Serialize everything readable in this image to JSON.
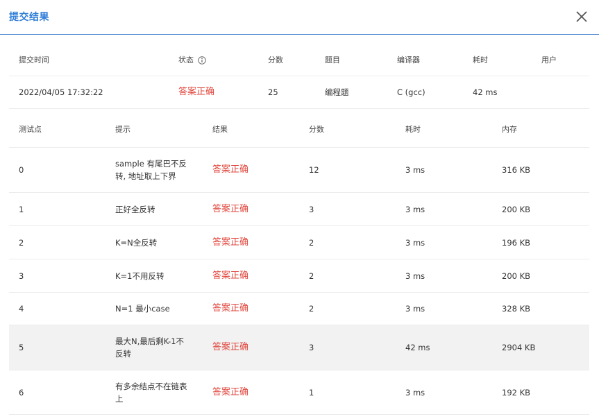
{
  "dialog": {
    "title": "提交结果",
    "close_icon": "close-icon"
  },
  "summary": {
    "headers": {
      "time": "提交时间",
      "status": "状态",
      "score": "分数",
      "problem": "题目",
      "compiler": "编译器",
      "duration": "耗时",
      "user": "用户"
    },
    "row": {
      "time": "2022/04/05 17:32:22",
      "status": "答案正确",
      "score": "25",
      "problem": "编程题",
      "compiler": "C (gcc)",
      "duration": "42 ms",
      "user": ""
    }
  },
  "testcases": {
    "headers": {
      "id": "测试点",
      "hint": "提示",
      "result": "结果",
      "score": "分数",
      "duration": "耗时",
      "memory": "内存"
    },
    "rows": [
      {
        "id": "0",
        "hint": "sample 有尾巴不反转, 地址取上下界",
        "result": "答案正确",
        "score": "12",
        "duration": "3 ms",
        "memory": "316 KB"
      },
      {
        "id": "1",
        "hint": "正好全反转",
        "result": "答案正确",
        "score": "3",
        "duration": "3 ms",
        "memory": "200 KB"
      },
      {
        "id": "2",
        "hint": "K=N全反转",
        "result": "答案正确",
        "score": "2",
        "duration": "3 ms",
        "memory": "196 KB"
      },
      {
        "id": "3",
        "hint": "K=1不用反转",
        "result": "答案正确",
        "score": "2",
        "duration": "3 ms",
        "memory": "200 KB"
      },
      {
        "id": "4",
        "hint": "N=1 最小case",
        "result": "答案正确",
        "score": "2",
        "duration": "3 ms",
        "memory": "328 KB"
      },
      {
        "id": "5",
        "hint": "最大N,最后剩K-1不反转",
        "result": "答案正确",
        "score": "3",
        "duration": "42 ms",
        "memory": "2904 KB"
      },
      {
        "id": "6",
        "hint": "有多余结点不在链表上",
        "result": "答案正确",
        "score": "1",
        "duration": "3 ms",
        "memory": "192 KB"
      }
    ]
  },
  "colors": {
    "accent": "#2f7ed8",
    "status_ok": "#e0463c",
    "highlight_row": "#f2f2f2"
  }
}
